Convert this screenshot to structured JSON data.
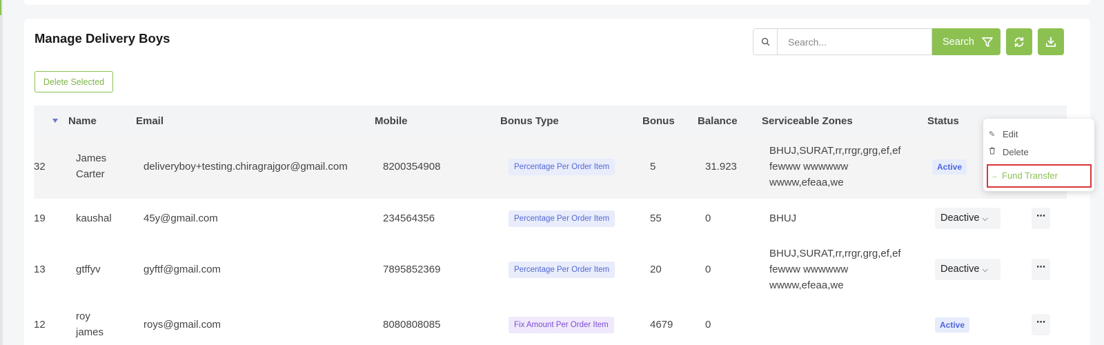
{
  "page": {
    "title": "Manage Delivery Boys",
    "search_placeholder": "Search...",
    "search_button": "Search",
    "delete_selected": "Delete Selected"
  },
  "toolbar_icons": [
    "search-icon",
    "filter-icon",
    "refresh-icon",
    "download-icon"
  ],
  "colors": {
    "accent": "#8cc152",
    "highlight_border": "#d9353a",
    "badge_blue": "#5468d4",
    "badge_purple": "#7b4cd6"
  },
  "table": {
    "headers": {
      "name": "Name",
      "email": "Email",
      "mobile": "Mobile",
      "bonus_type": "Bonus Type",
      "bonus": "Bonus",
      "balance": "Balance",
      "zones": "Serviceable Zones",
      "status": "Status"
    },
    "rows": [
      {
        "id": "32",
        "name_line1": "James",
        "name_line2": "Carter",
        "email": "deliveryboy+testing.chiragrajgor@gmail.com",
        "mobile": "8200354908",
        "bonus_type": "Percentage Per Order Item",
        "bonus": "5",
        "balance": "31.923",
        "zones_line1": "BHUJ,SURAT,rr,rrgr,grg,ef,ef",
        "zones_line2": "fewww wwwwww",
        "zones_line3": "wwww,efeaa,we",
        "status": "Active"
      },
      {
        "id": "19",
        "name_line1": "kaushal",
        "email": "45y@gmail.com",
        "mobile": "234564356",
        "bonus_type": "Percentage Per Order Item",
        "bonus": "55",
        "balance": "0",
        "zones_line1": "BHUJ",
        "status": "Deactive"
      },
      {
        "id": "13",
        "name_line1": "gtffyv",
        "email": "gyftf@gmail.com",
        "mobile": "7895852369",
        "bonus_type": "Percentage Per Order Item",
        "bonus": "20",
        "balance": "0",
        "zones_line1": "BHUJ,SURAT,rr,rrgr,grg,ef,ef",
        "zones_line2": "fewww wwwwww",
        "zones_line3": "wwww,efeaa,we",
        "status": "Deactive"
      },
      {
        "id": "12",
        "name_line1": "roy",
        "name_line2": "james",
        "email": "roys@gmail.com",
        "mobile": "8080808085",
        "bonus_type": "Fix Amount Per Order Item",
        "bonus": "4679",
        "balance": "0",
        "status": "Active"
      }
    ]
  },
  "action_menu": {
    "edit": "Edit",
    "delete": "Delete",
    "fund_transfer": "Fund Transfer"
  }
}
